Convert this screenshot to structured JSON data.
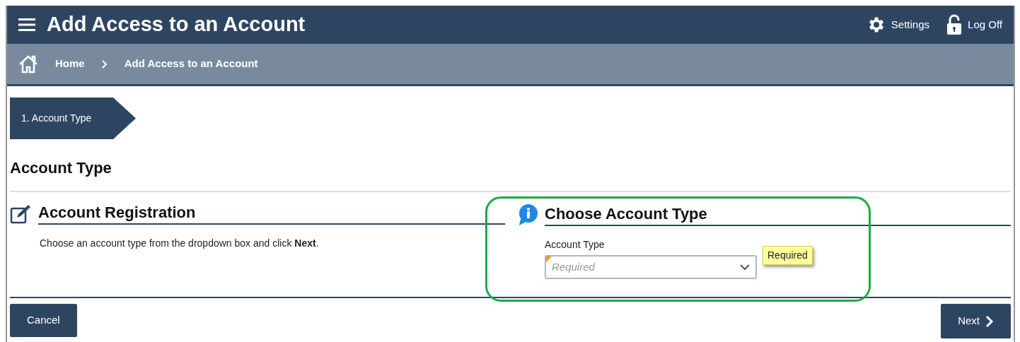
{
  "header": {
    "title": "Add Access to an Account",
    "actions": [
      {
        "kind": "settings",
        "label": "Settings"
      },
      {
        "kind": "logoff",
        "label": "Log Off"
      }
    ]
  },
  "breadcrumb": [
    "Home",
    "Add Access to an Account"
  ],
  "steps": [
    {
      "label": "1. Account Type",
      "selected": true
    }
  ],
  "section_title": "Account Type",
  "left_panel": {
    "title": "Account Registration",
    "text": "Choose an account type from the dropdown box and click **Next**."
  },
  "right_panel": {
    "title": "Choose Account Type",
    "field": {
      "label": "Account Type",
      "placeholder": "Required",
      "required": true
    },
    "tooltip": "Required",
    "highlighted": true
  },
  "buttons": {
    "cancel": "Cancel",
    "next": "Next"
  }
}
